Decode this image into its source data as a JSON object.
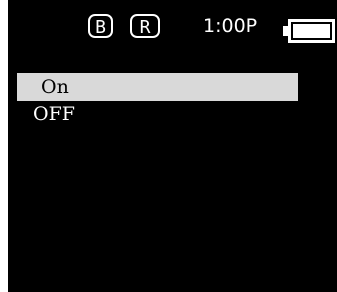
{
  "status_bar": {
    "badge_b": "B",
    "badge_r": "R",
    "time": "1:00P",
    "battery_icon": "battery-full-icon",
    "battery_level": 1.0
  },
  "menu": {
    "items": [
      {
        "label": "On",
        "selected": true
      },
      {
        "label": "OFF",
        "selected": false
      }
    ]
  },
  "colors": {
    "background": "#000000",
    "foreground": "#ffffff",
    "selection": "#d9d9d9"
  }
}
